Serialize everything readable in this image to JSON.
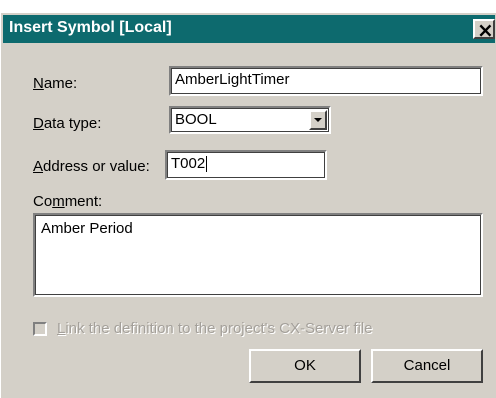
{
  "window": {
    "title": "Insert Symbol [Local]",
    "close_icon": "close-icon"
  },
  "form": {
    "name_label": "Name:",
    "name_value": "AmberLightTimer",
    "datatype_label": "Data type:",
    "datatype_value": "BOOL",
    "address_label": "Address or value:",
    "address_value": "T002",
    "comment_label": "Comment:",
    "comment_value": "Amber Period",
    "link_label": "Link the definition to the project's CX-Server file",
    "link_checked": false
  },
  "buttons": {
    "ok": "OK",
    "cancel": "Cancel"
  }
}
